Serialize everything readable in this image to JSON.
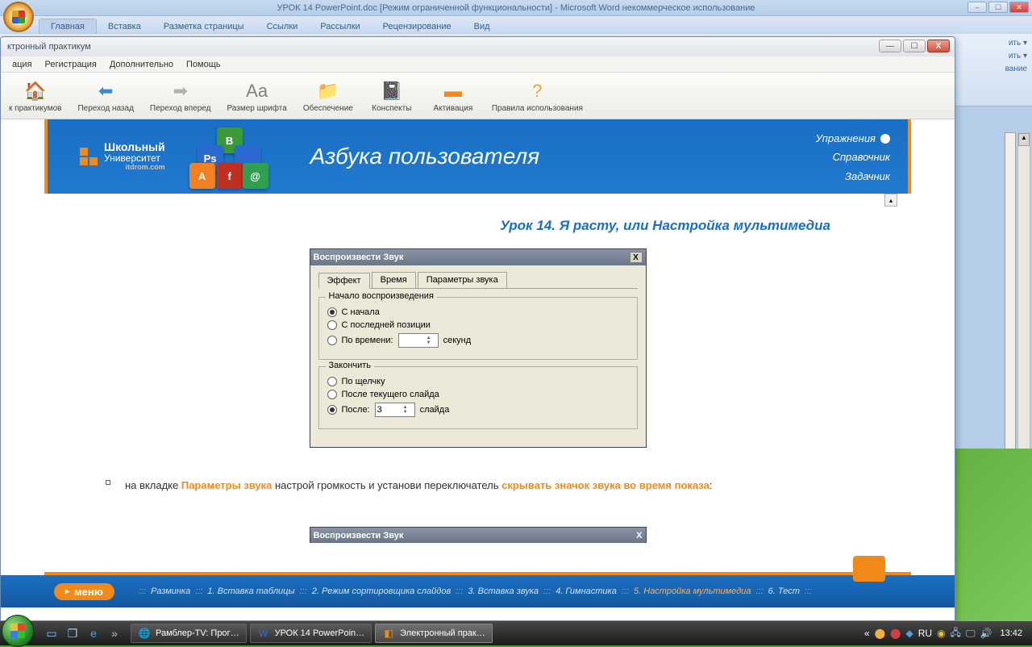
{
  "word": {
    "title": "УРОК 14 PowerPoint.doc [Режим ограниченной функциональности] - Microsoft Word некоммерческое использование",
    "tabs": [
      "Главная",
      "Вставка",
      "Разметка страницы",
      "Ссылки",
      "Рассылки",
      "Рецензирование",
      "Вид"
    ],
    "ribbon_right": [
      "ить ▾",
      "ить ▾",
      "вание"
    ]
  },
  "prac": {
    "title": "ктронный практикум",
    "menu": [
      "ация",
      "Регистрация",
      "Дополнительно",
      "Помощь"
    ],
    "toolbar": [
      {
        "icon": "🏠",
        "label": "к практикумов",
        "color": "#f28a1a"
      },
      {
        "icon": "⬅",
        "label": "Переход назад",
        "color": "#3a8ad0"
      },
      {
        "icon": "➡",
        "label": "Переход вперед",
        "color": "#b0b0b0"
      },
      {
        "icon": "Aa",
        "label": "Размер шрифта",
        "color": "#808080"
      },
      {
        "icon": "📁",
        "label": "Обеспечение",
        "color": "#f0a040"
      },
      {
        "icon": "📓",
        "label": "Конспекты",
        "color": "#909090"
      },
      {
        "icon": "▬",
        "label": "Активация",
        "color": "#f28a1a"
      },
      {
        "icon": "?",
        "label": "Правила использования",
        "color": "#f0a030"
      }
    ]
  },
  "site": {
    "logo1": "Школьный",
    "logo2": "Университет",
    "logo3": "itdrom.com",
    "title": "Азбука пользователя",
    "links": [
      "Упражнения",
      "Справочник",
      "Задачник"
    ],
    "lesson": "Урок 14. Я расту, или Настройка мультимедиа"
  },
  "dlg": {
    "title": "Воспроизвести Звук",
    "tabs": [
      "Эффект",
      "Время",
      "Параметры звука"
    ],
    "group1": "Начало воспроизведения",
    "r1": "С начала",
    "r2": "С последней позиции",
    "r3": "По времени:",
    "r3_unit": "секунд",
    "group2": "Закончить",
    "r4": "По щелчку",
    "r5": "После текущего слайда",
    "r6": "После:",
    "r6_val": "3",
    "r6_unit": "слайда"
  },
  "instr": {
    "t1": "на вкладке ",
    "h1": "Параметры звука",
    "t2": " настрой громкость и установи переключатель ",
    "h2": "скрывать значок звука во время показа",
    "t3": ":"
  },
  "footer": {
    "menu": "меню",
    "crumbs": [
      {
        "t": "Разминка",
        "a": false
      },
      {
        "t": "1. Вставка таблицы",
        "a": false
      },
      {
        "t": "2. Режим сортировщика слайдов",
        "a": false
      },
      {
        "t": "3. Вставка звука",
        "a": false
      },
      {
        "t": "4. Гимнастика",
        "a": false
      },
      {
        "t": "5. Настройка мультимедиа",
        "a": true
      },
      {
        "t": "6. Тест",
        "a": false
      }
    ]
  },
  "taskbar": {
    "items": [
      {
        "icon": "🌐",
        "label": "Рамблер-ТV: Прог…",
        "color": "#30a0e0"
      },
      {
        "icon": "W",
        "label": "УРОК 14 PowerPoin…",
        "color": "#3a6ad0"
      },
      {
        "icon": "◧",
        "label": "Электронный прак…",
        "color": "#f28a1a",
        "active": true
      }
    ],
    "lang": "RU",
    "time": "13:42"
  }
}
